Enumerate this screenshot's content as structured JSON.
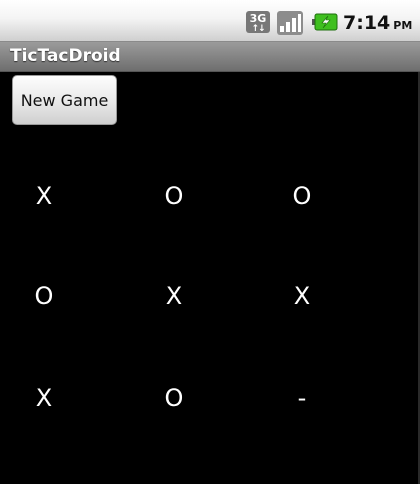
{
  "status_bar": {
    "network_badge": "3G",
    "time": "7:14",
    "ampm": "PM",
    "icons": [
      "3g-data-icon",
      "signal-strength-icon",
      "battery-charging-icon"
    ]
  },
  "app": {
    "title": "TicTacDroid"
  },
  "controls": {
    "new_game_label": "New Game"
  },
  "board": {
    "rows": [
      [
        "X",
        "O",
        "O"
      ],
      [
        "O",
        "X",
        "X"
      ],
      [
        "X",
        "O",
        "-"
      ]
    ]
  },
  "colors": {
    "background": "#000000",
    "cell_text": "#ffffff",
    "title_bar": "#7f7f7f",
    "battery_green": "#3fbf1f"
  }
}
